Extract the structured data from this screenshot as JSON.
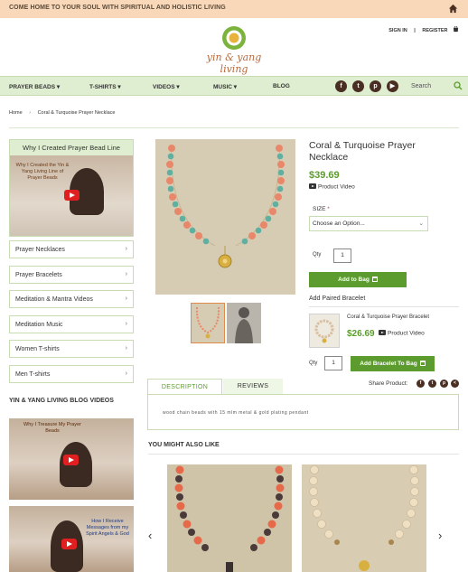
{
  "topbar": {
    "promo": "COME HOME TO YOUR SOUL WITH SPIRITUAL AND HOLISTIC LIVING",
    "home_icon": "home-icon"
  },
  "header": {
    "logo_text": "yin & yang living",
    "signin": "SIGN IN",
    "register": "REGISTER",
    "cart_icon": "cart-icon"
  },
  "nav": {
    "items": [
      "PRAYER BEADS ▾",
      "T-SHIRTS ▾",
      "VIDEOS ▾",
      "MUSIC ▾",
      "BLOG"
    ],
    "social": [
      "f",
      "t",
      "p",
      "▶"
    ],
    "search_label": "Search"
  },
  "breadcrumb": {
    "home": "Home",
    "sep": "›",
    "current": "Coral & Turquoise Prayer Necklace"
  },
  "sidebar": {
    "video_title": "Why I Created Prayer Bead Line",
    "video_caption": "Why I Created the Yin & Yang Living Line of Prayer Beads",
    "categories": [
      "Prayer Necklaces",
      "Prayer Bracelets",
      "Meditation & Mantra Videos",
      "Meditation Music",
      "Women T-shirts",
      "Men T-shirts"
    ],
    "chevron": "›",
    "blog_heading": "YIN & YANG LIVING BLOG VIDEOS",
    "blog_videos": [
      "Why I Treasure My Prayer Beads",
      "How I Receive Messages from my Spirit Angels & God"
    ]
  },
  "product": {
    "title": "Coral & Turquoise Prayer Necklace",
    "price": "$39.69",
    "video_link": "Product Video",
    "size_label": "SIZE",
    "size_required": "*",
    "size_placeholder": "Choose an Option...",
    "qty_label": "Qty",
    "qty_value": "1",
    "add_to_bag": "Add to Bag"
  },
  "paired": {
    "heading": "Add Paired Bracelet",
    "name": "Coral & Turquoise Prayer Bracelet",
    "price": "$26.69",
    "video_link": "Product Video",
    "qty_label": "Qty",
    "qty_value": "1",
    "add_button": "Add Bracelet To Bag"
  },
  "share": {
    "label": "Share Product:",
    "icons": [
      "f",
      "t",
      "p",
      "<"
    ]
  },
  "tabs": {
    "description": "DESCRIPTION",
    "reviews": "REVIEWS",
    "description_text": "wood chain beads with 15 mlm metal & gold plating pendant"
  },
  "related": {
    "heading": "YOU MIGHT ALSO LIKE",
    "prev": "‹",
    "next": "›"
  },
  "colors": {
    "topbar": "#f8d8b8",
    "nav": "#dfeed0",
    "accent_green": "#5c9c2e",
    "social_dark": "#4a2e22",
    "logo_orange": "#b86a3c"
  }
}
